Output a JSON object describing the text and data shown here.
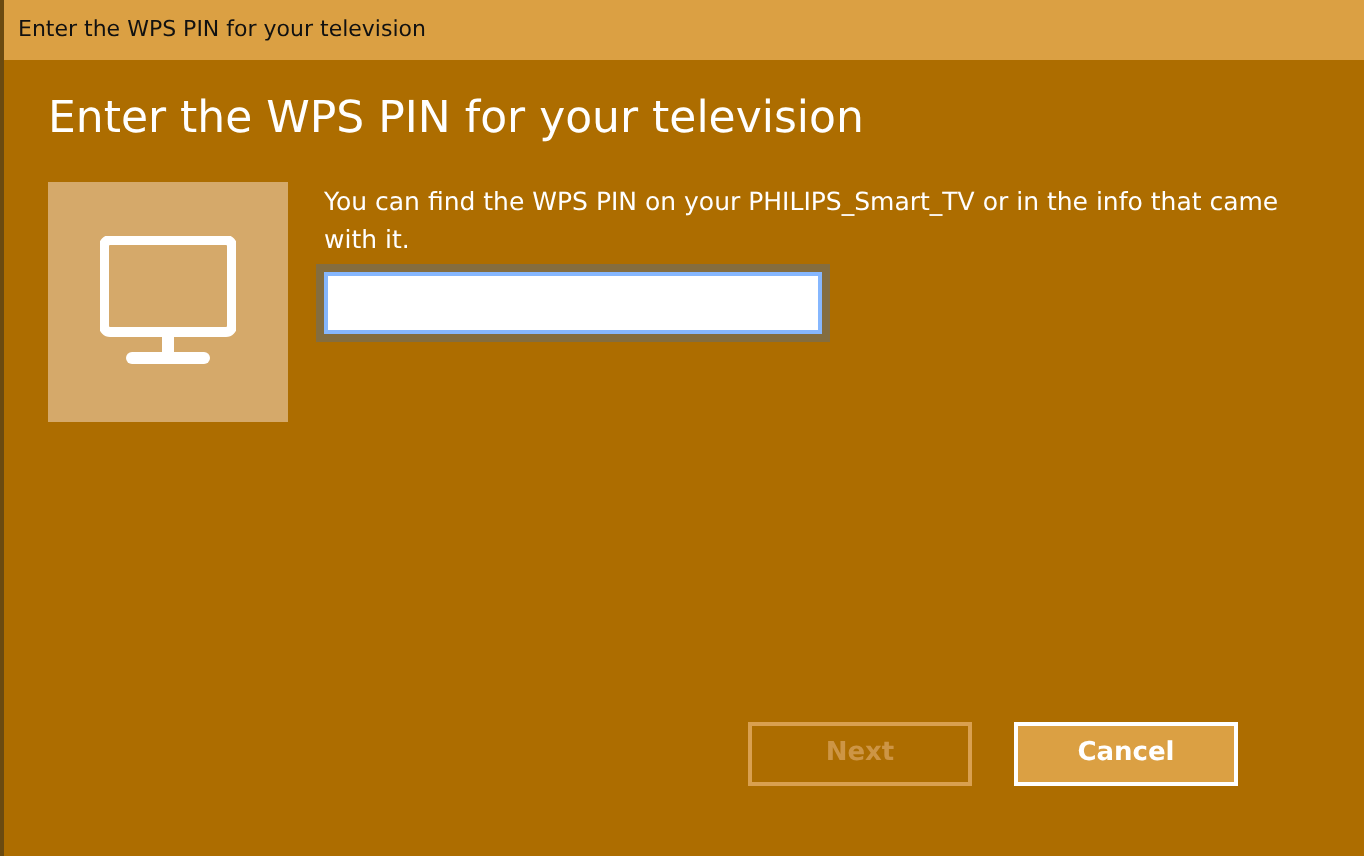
{
  "window": {
    "title": "Enter the WPS PIN for your television"
  },
  "heading": "Enter the WPS PIN for your television",
  "message": "You can find the WPS PIN on your PHILIPS_Smart_TV or in the info that came with it.",
  "pin_field": {
    "focused": true
  },
  "buttons": [
    {
      "label": "Next",
      "disabled": true,
      "focused": false
    },
    {
      "label": "Cancel",
      "disabled": false,
      "focused": true
    }
  ]
}
